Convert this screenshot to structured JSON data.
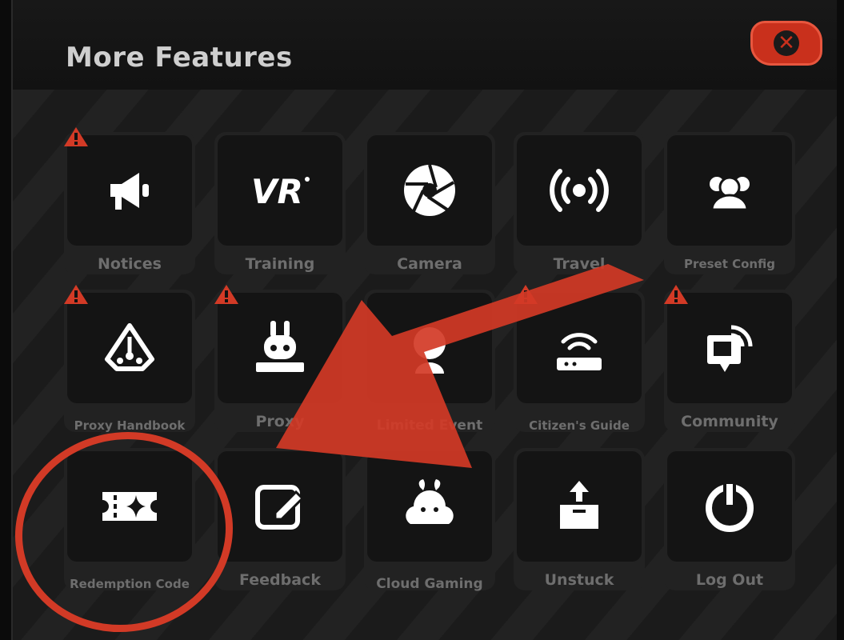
{
  "panel": {
    "title": "More Features"
  },
  "close_button": {
    "icon": "close-icon"
  },
  "accent": "#d23a26",
  "tiles": [
    {
      "label": "Notices",
      "icon": "megaphone-icon",
      "alert": true
    },
    {
      "label": "Training",
      "icon": "vr-icon",
      "alert": false
    },
    {
      "label": "Camera",
      "icon": "aperture-icon",
      "alert": false
    },
    {
      "label": "Travel",
      "icon": "broadcast-icon",
      "alert": false
    },
    {
      "label": "Preset Config",
      "icon": "people-icon",
      "alert": false
    },
    {
      "label": "Proxy Handbook",
      "icon": "handbook-icon",
      "alert": true
    },
    {
      "label": "Proxy",
      "icon": "bangboo-icon",
      "alert": true
    },
    {
      "label": "Limited Event",
      "icon": "event-icon",
      "alert": false
    },
    {
      "label": "Citizen's Guide",
      "icon": "router-icon",
      "alert": true
    },
    {
      "label": "Community",
      "icon": "community-icon",
      "alert": true
    },
    {
      "label": "Redemption Code",
      "icon": "ticket-icon",
      "alert": false
    },
    {
      "label": "Feedback",
      "icon": "edit-icon",
      "alert": false
    },
    {
      "label": "Cloud Gaming",
      "icon": "cloud-icon",
      "alert": false
    },
    {
      "label": "Unstuck",
      "icon": "box-up-icon",
      "alert": false
    },
    {
      "label": "Log Out",
      "icon": "power-icon",
      "alert": false
    }
  ]
}
